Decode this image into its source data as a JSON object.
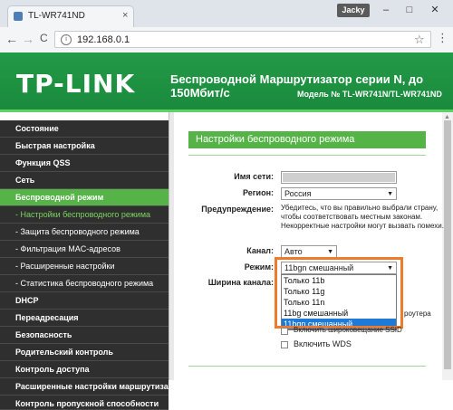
{
  "browser": {
    "tab_title": "TL-WR741ND",
    "tab_close": "×",
    "user_badge": "Jacky",
    "win_minimize": "–",
    "win_maximize": "□",
    "win_close": "✕",
    "back": "←",
    "forward": "→",
    "reload": "C",
    "url": "192.168.0.1",
    "star": "☆",
    "menu": "⋮"
  },
  "header": {
    "logo": "TP-LINK",
    "title": "Беспроводной Маршрутизатор серии N, до 150Мбит/с",
    "model": "Модель № TL-WR741N/TL-WR741ND"
  },
  "sidebar": {
    "items": [
      {
        "label": "Состояние"
      },
      {
        "label": "Быстрая настройка"
      },
      {
        "label": "Функция QSS"
      },
      {
        "label": "Сеть"
      },
      {
        "label": "Беспроводной режим"
      },
      {
        "label": "- Настройки беспроводного режима"
      },
      {
        "label": "- Защита беспроводного режима"
      },
      {
        "label": "- Фильтрация MAC-адресов"
      },
      {
        "label": "- Расширенные настройки"
      },
      {
        "label": "- Статистика беспроводного режима"
      },
      {
        "label": "DHCP"
      },
      {
        "label": "Переадресация"
      },
      {
        "label": "Безопасность"
      },
      {
        "label": "Родительский контроль"
      },
      {
        "label": "Контроль доступа"
      },
      {
        "label": "Расширенные настройки маршрутизации"
      },
      {
        "label": "Контроль пропускной способности"
      }
    ]
  },
  "main": {
    "section_title": "Настройки беспроводного режима",
    "ssid_label": "Имя сети:",
    "region_label": "Регион:",
    "region_value": "Россия",
    "warning_label": "Предупреждение:",
    "warning_text": "Убедитесь, что вы правильно выбрали страну, чтобы соответствовать местным законам. Некорректные настройки могут вызвать помехи.",
    "channel_label": "Канал:",
    "channel_value": "Авто",
    "mode_label": "Режим:",
    "mode_value": "11bgn смешанный",
    "width_label": "Ширина канала:",
    "mode_options": [
      "Только 11b",
      "Только 11g",
      "Только 11n",
      "11bg смешанный",
      "11bgn смешанный"
    ],
    "router_text": "роутера",
    "ssid_broadcast_label": "Включить широковещание SSID",
    "wds_label": "Включить WDS"
  },
  "colors": {
    "brand_green": "#1b8e40",
    "active_green": "#56b347",
    "highlight_orange": "#ee7b2b",
    "selected_blue": "#1e7ad6"
  }
}
